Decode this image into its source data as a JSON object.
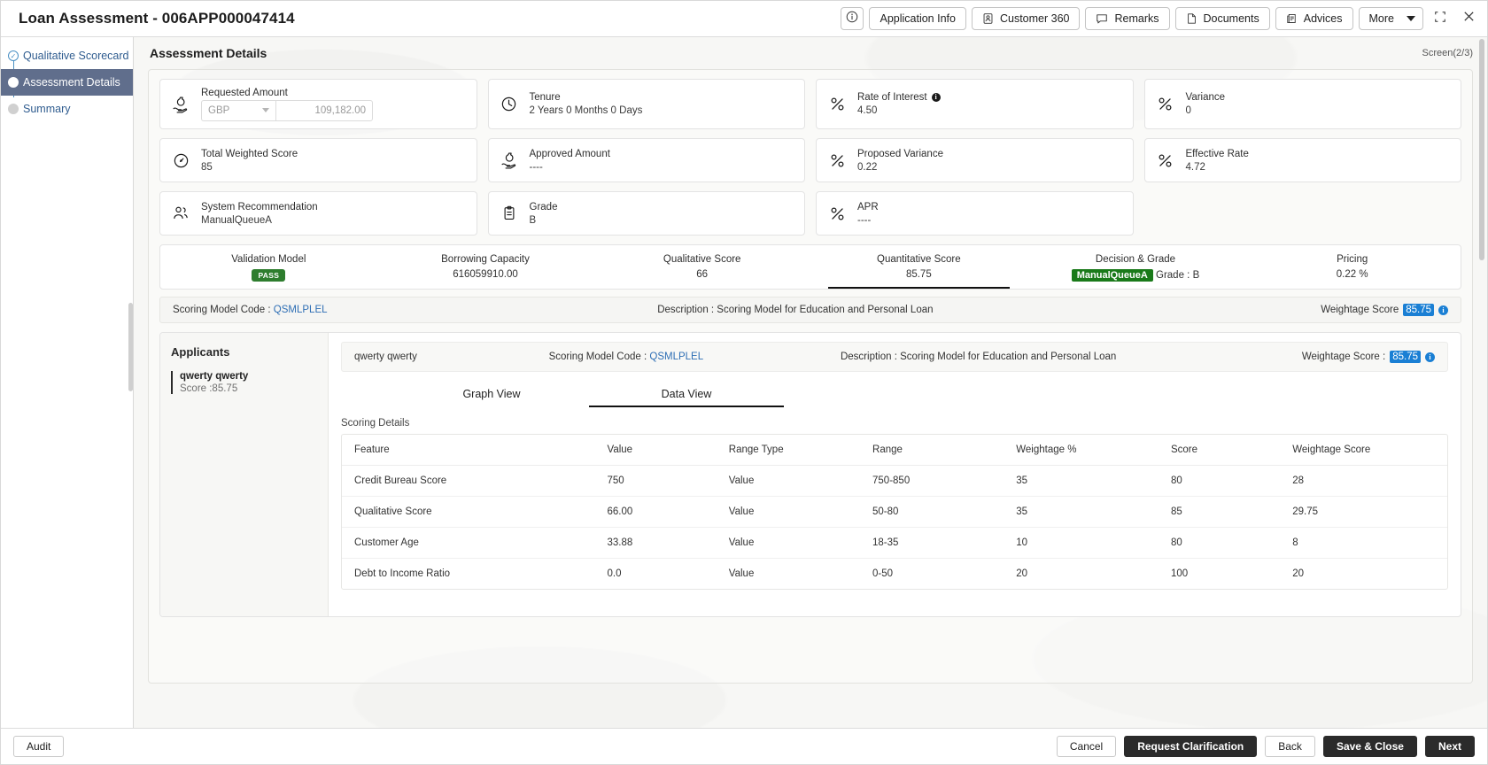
{
  "window": {
    "title": "Loan Assessment - 006APP000047414",
    "actions": [
      {
        "name": "info",
        "label": "",
        "icon": "info-circle-icon"
      },
      {
        "name": "application-info",
        "label": "Application Info",
        "icon": ""
      },
      {
        "name": "customer-360",
        "label": "Customer 360",
        "icon": "user-badge-icon"
      },
      {
        "name": "remarks",
        "label": "Remarks",
        "icon": "comment-icon"
      },
      {
        "name": "documents",
        "label": "Documents",
        "icon": "document-icon"
      },
      {
        "name": "advices",
        "label": "Advices",
        "icon": "advice-icon"
      },
      {
        "name": "more",
        "label": "More",
        "icon": "chevron-down-icon"
      }
    ],
    "minimize_label": "",
    "close_label": "✕"
  },
  "sidebar": {
    "items": [
      {
        "label": "Qualitative Scorecard",
        "state": "completed"
      },
      {
        "label": "Assessment Details",
        "state": "active"
      },
      {
        "label": "Summary",
        "state": "pending"
      }
    ]
  },
  "main": {
    "title": "Assessment Details",
    "screen_counter": "Screen(2/3)"
  },
  "tiles": [
    {
      "name": "requested-amount",
      "icon": "money-hand-icon",
      "label": "Requested Amount",
      "type": "amount",
      "currency": "GBP",
      "amount": "109,182.00"
    },
    {
      "name": "tenure",
      "icon": "clock-icon",
      "label": "Tenure",
      "value": "2 Years 0 Months 0 Days"
    },
    {
      "name": "rate-of-interest",
      "icon": "percent-icon",
      "label": "Rate of Interest",
      "value": "4.50",
      "has_info": true
    },
    {
      "name": "variance",
      "icon": "percent-icon",
      "label": "Variance",
      "value": "0"
    },
    {
      "name": "total-weighted-score",
      "icon": "gauge-icon",
      "label": "Total Weighted Score",
      "value": "85"
    },
    {
      "name": "approved-amount",
      "icon": "money-hand-icon",
      "label": "Approved Amount",
      "value": "----"
    },
    {
      "name": "proposed-variance",
      "icon": "percent-icon",
      "label": "Proposed Variance",
      "value": "0.22"
    },
    {
      "name": "effective-rate",
      "icon": "percent-icon",
      "label": "Effective Rate",
      "value": "4.72"
    },
    {
      "name": "system-recommendation",
      "icon": "users-icon",
      "label": "System Recommendation",
      "value": "ManualQueueA"
    },
    {
      "name": "grade",
      "icon": "clipboard-icon",
      "label": "Grade",
      "value": "B"
    },
    {
      "name": "apr",
      "icon": "percent-icon",
      "label": "APR",
      "value": "----"
    }
  ],
  "stepper": [
    {
      "name": "validation-model",
      "label": "Validation Model",
      "badge": "PASS",
      "value": "",
      "active": false
    },
    {
      "name": "borrowing-capacity",
      "label": "Borrowing Capacity",
      "value": "616059910.00",
      "active": false
    },
    {
      "name": "qualitative-score",
      "label": "Qualitative Score",
      "value": "66",
      "active": false
    },
    {
      "name": "quantitative-score",
      "label": "Quantitative Score",
      "value": "85.75",
      "active": true
    },
    {
      "name": "decision-and-grade",
      "label": "Decision & Grade",
      "badge2": "ManualQueueA",
      "value": "Grade : B",
      "active": false
    },
    {
      "name": "pricing",
      "label": "Pricing",
      "value": "0.22 %",
      "active": false
    }
  ],
  "model_bar": {
    "code_label": "Scoring Model Code :",
    "code_value": "QSMLPLEL",
    "description": "Description : Scoring Model for Education and Personal Loan",
    "weightage_label": "Weightage Score",
    "weightage_value": "85.75"
  },
  "applicants": {
    "heading": "Applicants",
    "items": [
      {
        "name": "qwerty qwerty",
        "score": "Score :85.75"
      }
    ]
  },
  "detail_bar": {
    "applicant": "qwerty qwerty",
    "code_label": "Scoring Model Code :",
    "code_value": "QSMLPLEL",
    "description": "Description : Scoring Model for Education and Personal Loan",
    "weightage_label": "Weightage Score :",
    "weightage_value": "85.75"
  },
  "tabs": [
    {
      "name": "graph-view",
      "label": "Graph View",
      "active": false
    },
    {
      "name": "data-view",
      "label": "Data View",
      "active": true
    }
  ],
  "table": {
    "section_title": "Scoring Details",
    "columns": [
      "Feature",
      "Value",
      "Range Type",
      "Range",
      "Weightage %",
      "Score",
      "Weightage Score"
    ],
    "rows": [
      {
        "feature": "Credit Bureau Score",
        "link": false,
        "value": "750",
        "range_type": "Value",
        "range": "750-850",
        "weightage_pct": "35",
        "score": "80",
        "weightage_score": "28"
      },
      {
        "feature": "Qualitative Score",
        "link": false,
        "value": "66.00",
        "range_type": "Value",
        "range": "50-80",
        "weightage_pct": "35",
        "score": "85",
        "weightage_score": "29.75"
      },
      {
        "feature": "Customer Age",
        "link": false,
        "value": "33.88",
        "range_type": "Value",
        "range": "18-35",
        "weightage_pct": "10",
        "score": "80",
        "weightage_score": "8"
      },
      {
        "feature": "Debt to Income Ratio",
        "link": true,
        "value": "0.0",
        "range_type": "Value",
        "range": "0-50",
        "weightage_pct": "20",
        "score": "100",
        "weightage_score": "20"
      }
    ]
  },
  "footer": {
    "audit_label": "Audit",
    "cancel_label": "Cancel",
    "request_clarification_label": "Request Clarification",
    "back_label": "Back",
    "save_close_label": "Save & Close",
    "next_label": "Next"
  },
  "colors": {
    "accent_blue": "#1a7fd4",
    "pass_green": "#2e7d2e",
    "queue_green": "#1a7a1a",
    "nav_active": "#606e8c",
    "dark_button": "#2b2b2b"
  }
}
